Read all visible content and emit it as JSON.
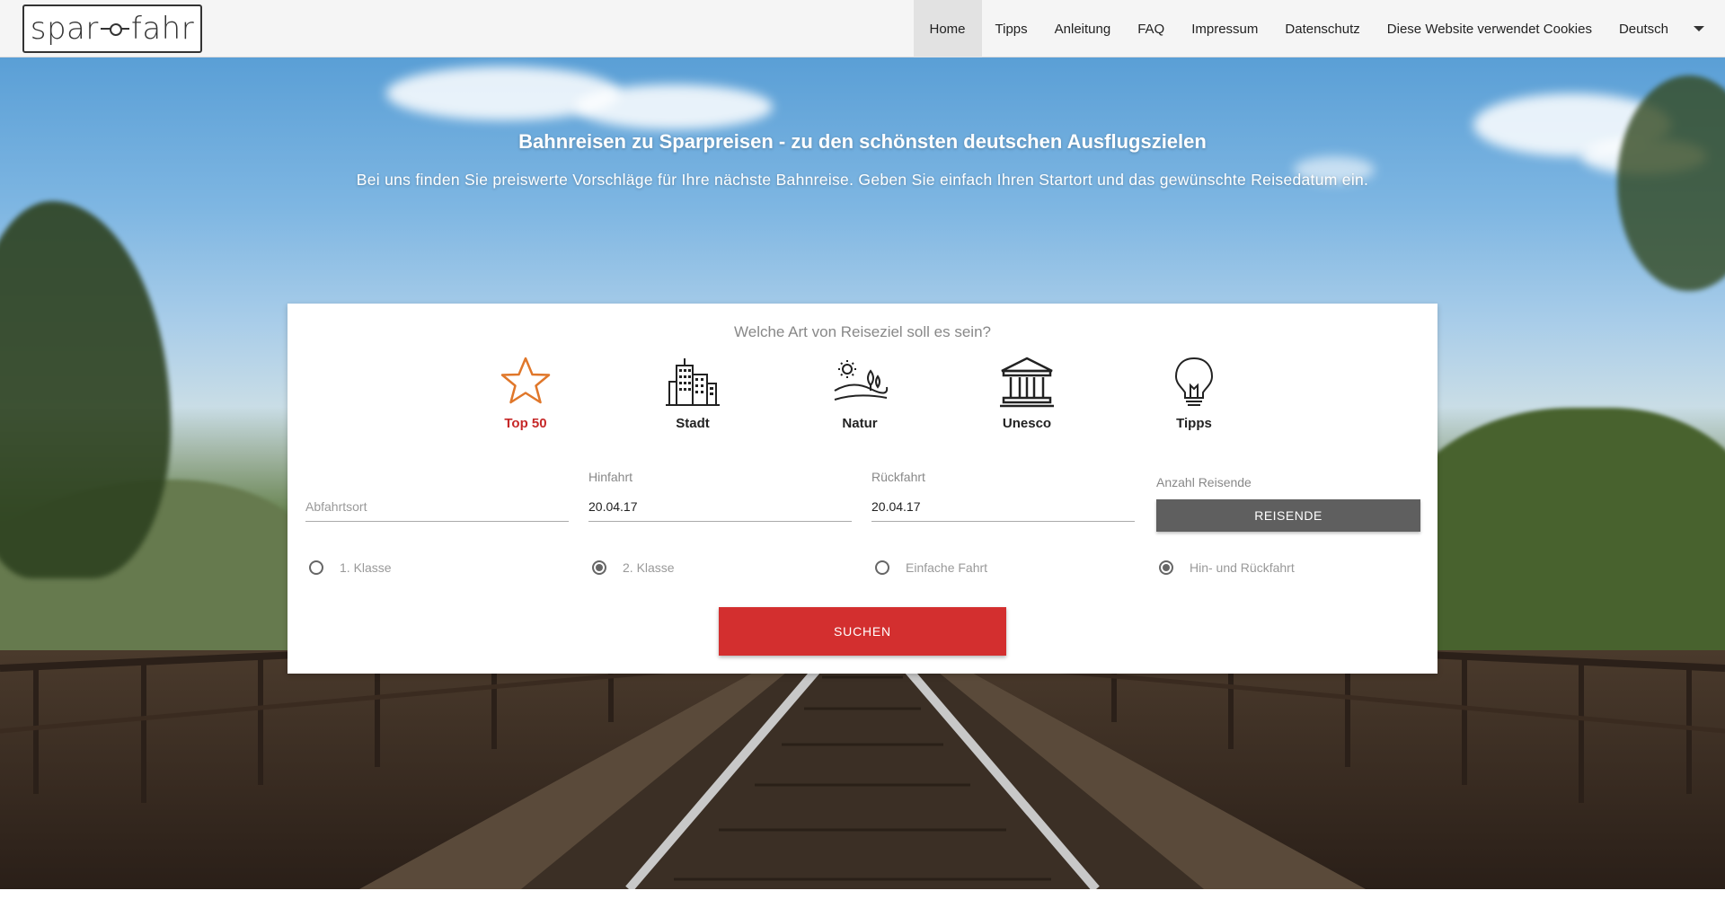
{
  "brand": {
    "logo_left": "spar",
    "logo_right": "fahr"
  },
  "nav": {
    "items": [
      {
        "label": "Home",
        "active": true
      },
      {
        "label": "Tipps"
      },
      {
        "label": "Anleitung"
      },
      {
        "label": "FAQ"
      },
      {
        "label": "Impressum"
      },
      {
        "label": "Datenschutz"
      },
      {
        "label": "Diese Website verwendet Cookies"
      },
      {
        "label": "Deutsch"
      }
    ]
  },
  "hero": {
    "title": "Bahnreisen zu Sparpreisen - zu den schönsten deutschen Ausflugszielen",
    "subtitle": "Bei uns finden Sie preiswerte Vorschläge für Ihre nächste Bahnreise. Geben Sie einfach Ihren Startort und das gewünschte Reisedatum ein."
  },
  "search": {
    "question": "Welche Art von Reiseziel soll es sein?",
    "categories": [
      {
        "label": "Top 50",
        "icon": "star-icon",
        "active": true
      },
      {
        "label": "Stadt",
        "icon": "city-icon"
      },
      {
        "label": "Natur",
        "icon": "nature-icon"
      },
      {
        "label": "Unesco",
        "icon": "museum-icon"
      },
      {
        "label": "Tipps",
        "icon": "lightbulb-icon"
      }
    ],
    "departure": {
      "placeholder": "Abfahrtsort",
      "value": ""
    },
    "outbound": {
      "label": "Hinfahrt",
      "value": "20.04.17"
    },
    "return": {
      "label": "Rückfahrt",
      "value": "20.04.17"
    },
    "travellers": {
      "label": "Anzahl Reisende",
      "button": "REISENDE"
    },
    "class_options": [
      {
        "label": "1. Klasse",
        "checked": false
      },
      {
        "label": "2. Klasse",
        "checked": true
      }
    ],
    "trip_options": [
      {
        "label": "Einfache Fahrt",
        "checked": false
      },
      {
        "label": "Hin- und Rückfahrt",
        "checked": true
      }
    ],
    "submit": "SUCHEN"
  },
  "colors": {
    "accent": "#d32f2f",
    "star_icon": "#e0772a",
    "travellers_button": "#5f5f5f",
    "nav_bg": "#f5f5f5"
  }
}
